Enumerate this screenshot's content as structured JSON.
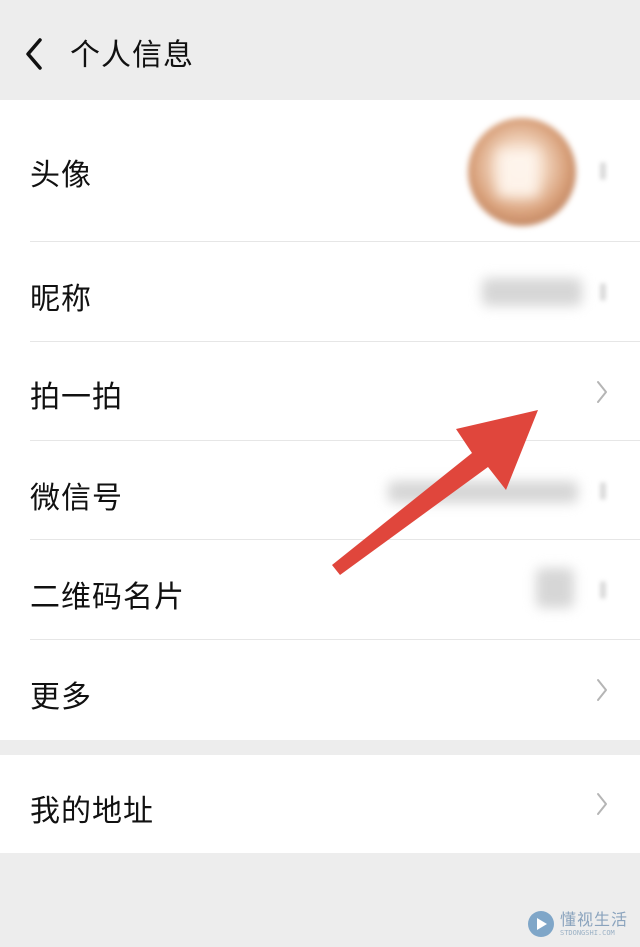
{
  "header": {
    "title": "个人信息"
  },
  "rows": [
    {
      "label": "头像"
    },
    {
      "label": "昵称"
    },
    {
      "label": "拍一拍"
    },
    {
      "label": "微信号"
    },
    {
      "label": "二维码名片"
    },
    {
      "label": "更多"
    }
  ],
  "address_row": {
    "label": "我的地址"
  },
  "colors": {
    "arrow": "#e0463c",
    "page_background": "#ededed",
    "row_background": "#ffffff"
  },
  "watermark": {
    "main": "懂视生活",
    "sub": "STDONGSHI.COM"
  }
}
